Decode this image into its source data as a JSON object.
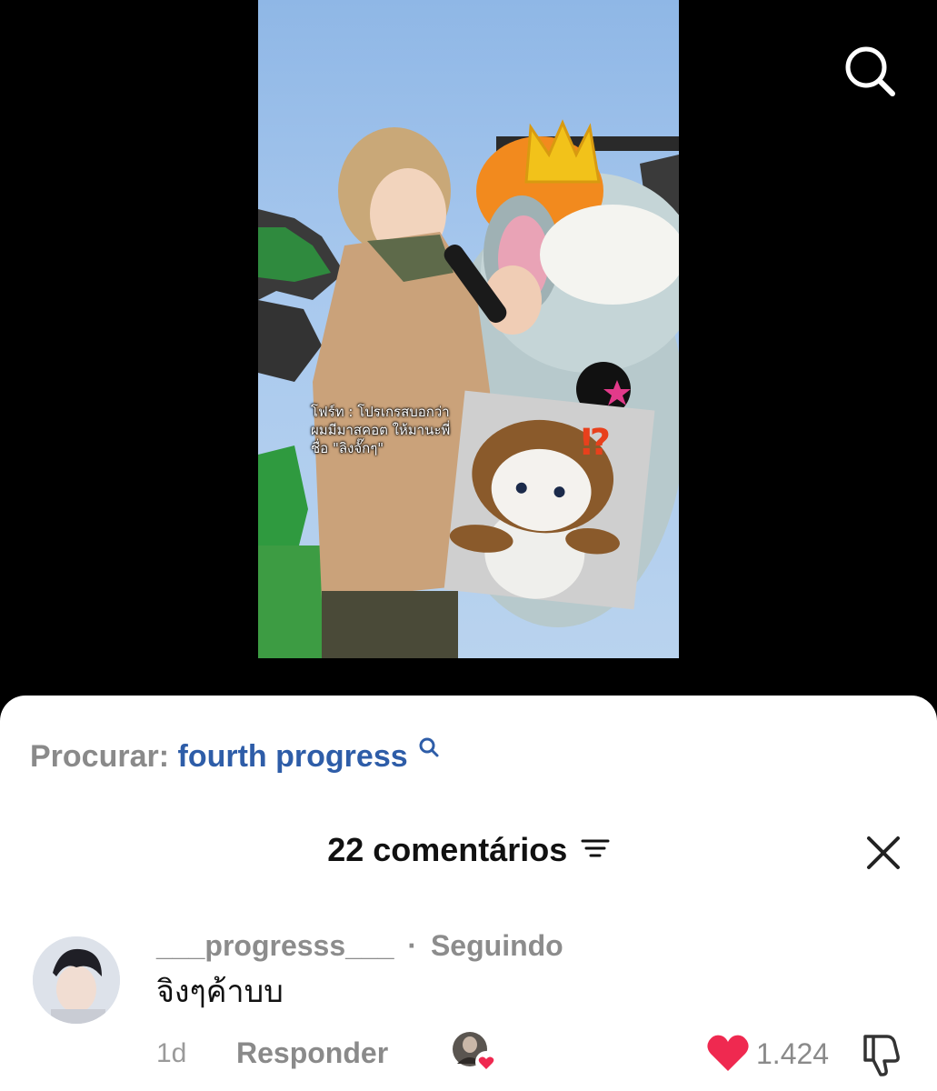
{
  "video": {
    "caption_lines": [
      "โฟร์ท : โปรเกรสบอกว่า",
      "ผมมีมาสคอต ให้มานะพี่",
      "ชื่อ \"ลิงจั๊กๆ\""
    ],
    "icons": {
      "search": "search-icon",
      "overlay_mark": "interrobang"
    }
  },
  "sheet": {
    "search_prefix": "Procurar:",
    "search_query": "fourth progress",
    "comments_title": "22 comentários",
    "icons": {
      "filter": "filter-icon",
      "close": "close-icon"
    }
  },
  "comment": {
    "username": "___progresss___",
    "separator": "·",
    "following_label": "Seguindo",
    "text": "จิงๆค้าบบ",
    "time": "1d",
    "reply_label": "Responder",
    "like_count": "1.424",
    "liked": true,
    "icons": {
      "like": "heart-icon",
      "dislike": "thumbs-down-icon",
      "creator_like": "creator-liked-heart-icon"
    }
  },
  "colors": {
    "like": "#ef2950",
    "link": "#2e5da8",
    "muted": "#8a8a8a"
  }
}
